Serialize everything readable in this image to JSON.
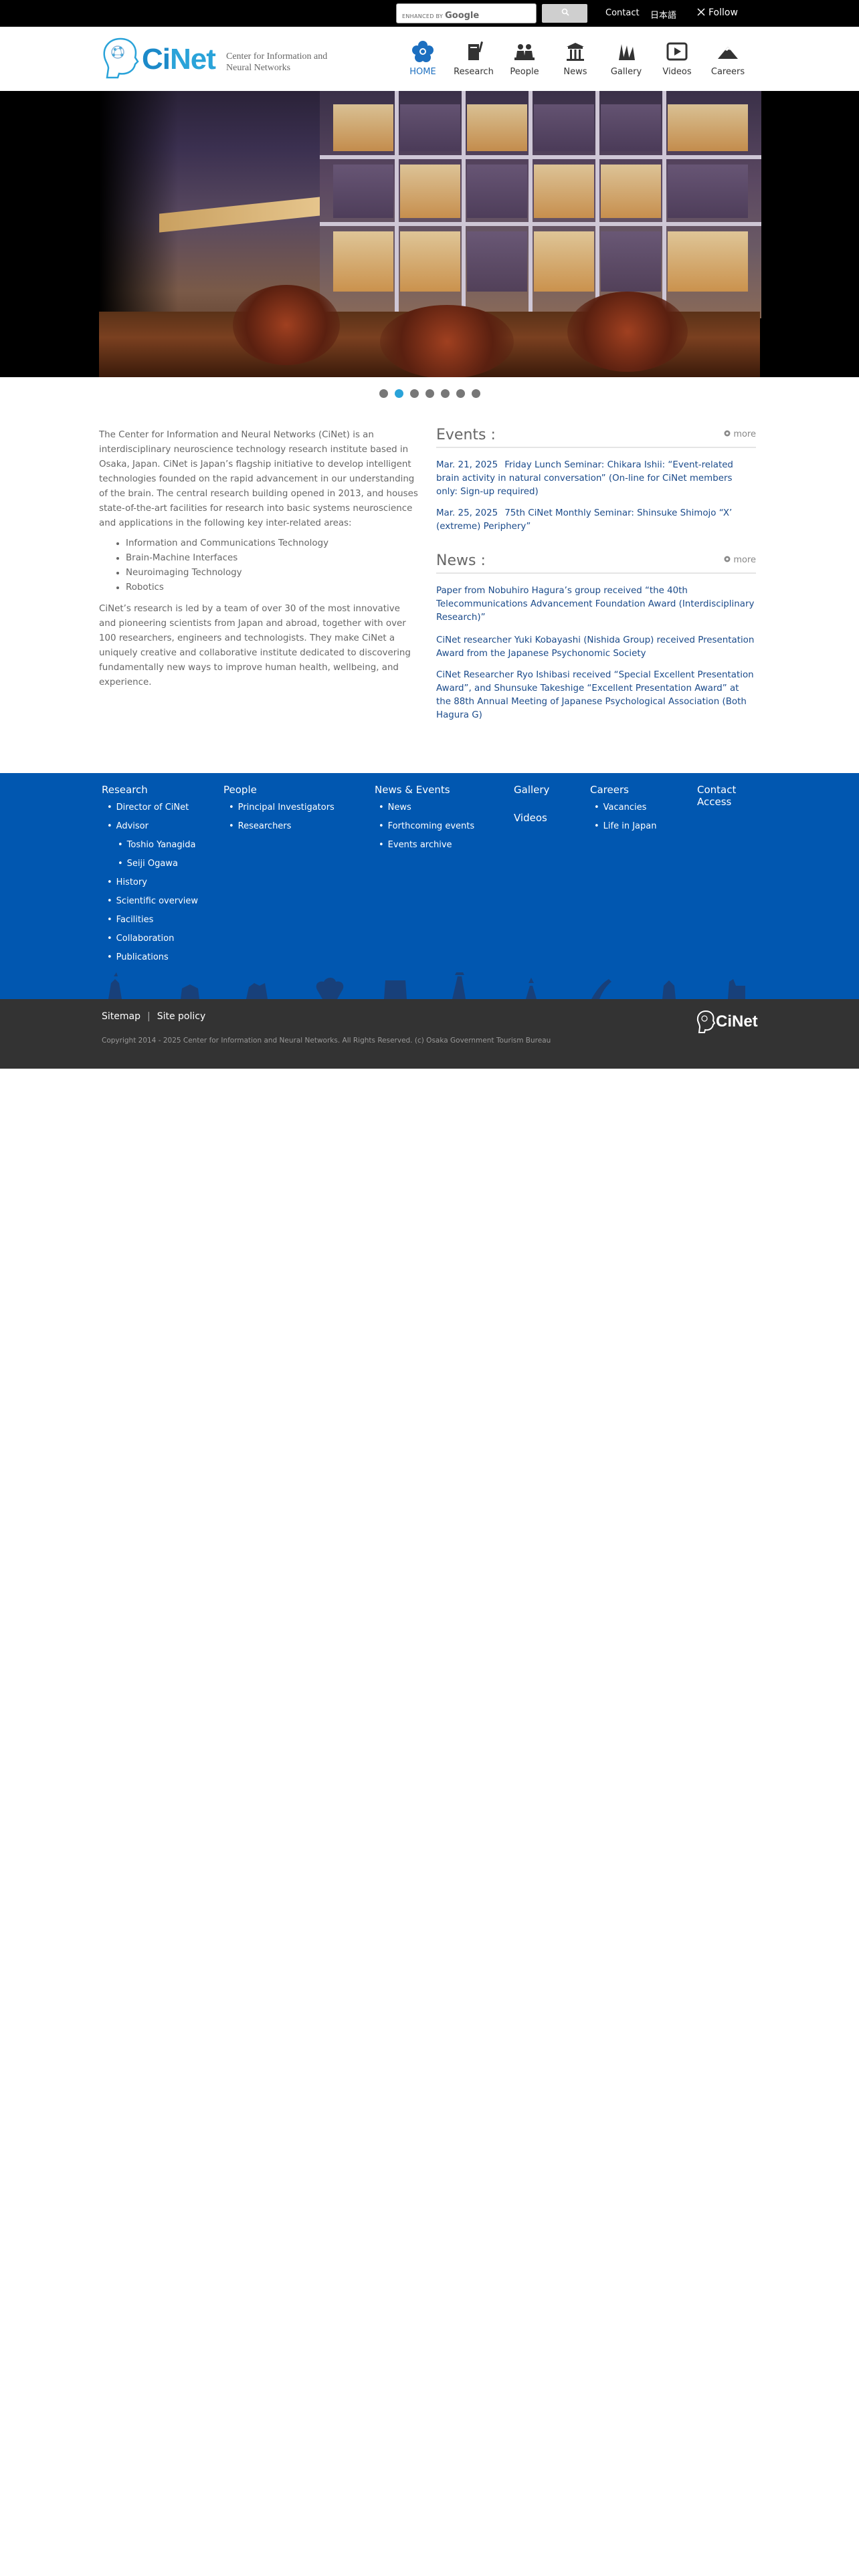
{
  "topbar": {
    "search_brand_small": "ENHANCED BY",
    "search_brand_name": "Google",
    "search_button_icon": "search-icon",
    "contact": "Contact",
    "japanese": "日本語",
    "follow": "Follow"
  },
  "header": {
    "logo_ci": "Ci",
    "logo_net": "Net",
    "logo_sub_line1": "Center for Information and",
    "logo_sub_line2": "Neural Networks"
  },
  "nav": [
    {
      "label": "HOME",
      "icon": "home-flower-icon",
      "active": true
    },
    {
      "label": "Research",
      "icon": "research-book-icon"
    },
    {
      "label": "People",
      "icon": "people-icon"
    },
    {
      "label": "News",
      "icon": "news-icon"
    },
    {
      "label": "Gallery",
      "icon": "gallery-icon"
    },
    {
      "label": "Videos",
      "icon": "play-icon"
    },
    {
      "label": "Careers",
      "icon": "mountain-icon"
    }
  ],
  "slider": {
    "count": 7,
    "active_index": 1
  },
  "intro": {
    "p1": "The Center for Information and Neural Networks (CiNet) is an interdisciplinary neuroscience technology research institute based in Osaka, Japan. CiNet is Japan’s flagship initiative to develop intelligent technologies founded on the rapid advancement in our understanding of the brain. The central research building opened in 2013, and houses state-of-the-art facilities for research into basic systems neuroscience and applications in the following key inter-related areas:",
    "areas": [
      "Information and Communications Technology",
      "Brain-Machine Interfaces",
      "Neuroimaging Technology",
      "Robotics"
    ],
    "p2": "CiNet’s research is led by a team of over 30 of the most innovative and pioneering scientists from Japan and abroad, together with over 100 researchers, engineers and technologists. They make CiNet a uniquely creative and collaborative institute dedicated to discovering fundamentally new ways to improve human health, wellbeing, and experience."
  },
  "events": {
    "title": "Events :",
    "more": "more",
    "items": [
      {
        "date": "Mar. 21, 2025",
        "text": "Friday Lunch Seminar: Chikara Ishii: “Event-related brain activity in natural conversation” (On-line for CiNet members only: Sign-up required)"
      },
      {
        "date": "Mar. 25, 2025",
        "text": "75th CiNet Monthly Seminar: Shinsuke Shimojo “X’ (extreme) Periphery”"
      }
    ]
  },
  "news": {
    "title": "News :",
    "more": "more",
    "items": [
      {
        "text": "Paper from Nobuhiro Hagura’s group received “the 40th Telecommunications Advancement Foundation Award (Interdisciplinary Research)”"
      },
      {
        "text": "CiNet researcher Yuki Kobayashi (Nishida Group) received Presentation Award from the Japanese Psychonomic Society"
      },
      {
        "text": "CiNet Researcher Ryo Ishibasi received “Special Excellent Presentation Award”, and Shunsuke Takeshige “Excellent Presentation Award” at the 88th Annual Meeting of Japanese Psychological Association (Both Hagura G)"
      }
    ]
  },
  "footer": {
    "research": "Research",
    "research_items": [
      "Director of CiNet",
      "Advisor",
      "Toshio Yanagida",
      "Seiji Ogawa",
      "History",
      "Scientific overview",
      "Facilities",
      "Collaboration",
      "Publications"
    ],
    "people": "People",
    "people_items": [
      "Principal Investigators",
      "Researchers"
    ],
    "news_events": "News & Events",
    "news_items": [
      "News",
      "Forthcoming events",
      "Events archive"
    ],
    "gallery": "Gallery",
    "videos": "Videos",
    "careers": "Careers",
    "careers_items": [
      "Vacancies",
      "Life in Japan"
    ],
    "contact_line1": "Contact",
    "contact_line2": "Access",
    "sitemap": "Sitemap",
    "sep": "|",
    "site_policy": "Site policy",
    "copyright": "Copyright 2014 - 2025 Center for Information and Neural Networks. All Rights Reserved.     (c) Osaka Government Tourism Bureau",
    "logo_text": "CiNet"
  },
  "colors": {
    "footer_blue": "#0157b0",
    "accent": "#2aa3d9",
    "link": "#1a4a8a"
  }
}
